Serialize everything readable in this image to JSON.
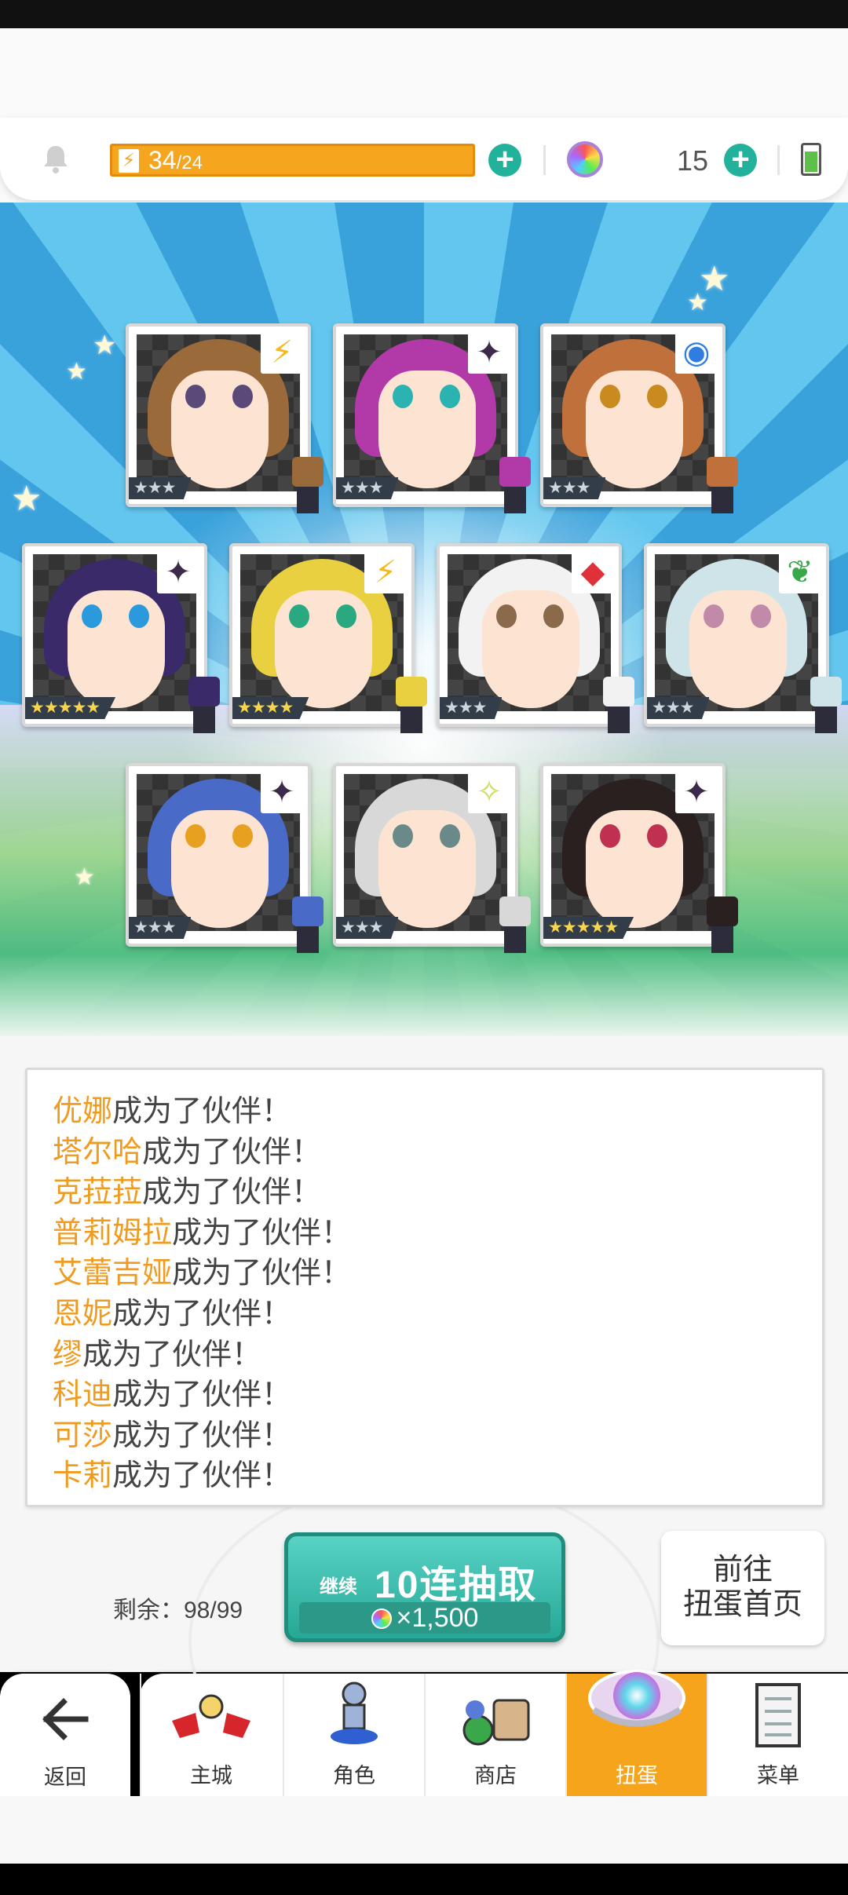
{
  "resources": {
    "stamina_current": "34",
    "stamina_max": "/24",
    "gem_count": "15"
  },
  "cards": [
    {
      "rarity": "★★★",
      "badge": "⚡",
      "badge_color": "#f6b81c",
      "hair": "#9a6a3a",
      "eye": "#5a4a7a"
    },
    {
      "rarity": "★★★",
      "badge": "✦",
      "badge_color": "#3b2a4a",
      "hair": "#b23aa8",
      "eye": "#2ab3b0"
    },
    {
      "rarity": "★★★",
      "badge": "◉",
      "badge_color": "#2f7de0",
      "hair": "#c0703a",
      "eye": "#c98a20"
    },
    {
      "rarity": "★★★★★",
      "badge": "✦",
      "badge_color": "#3b2a4a",
      "hair": "#3a2a6a",
      "eye": "#2a9adc"
    },
    {
      "rarity": "★★★★",
      "badge": "⚡",
      "badge_color": "#f6b81c",
      "hair": "#e8d040",
      "eye": "#2aa880"
    },
    {
      "rarity": "★★★",
      "badge": "◆",
      "badge_color": "#e0303a",
      "hair": "#f2f2f2",
      "eye": "#8a6a4a"
    },
    {
      "rarity": "★★★",
      "badge": "❦",
      "badge_color": "#3aa84a",
      "hair": "#cfe4e8",
      "eye": "#c08aa8"
    },
    {
      "rarity": "★★★",
      "badge": "✦",
      "badge_color": "#3b2a4a",
      "hair": "#4a6ac8",
      "eye": "#e8a020"
    },
    {
      "rarity": "★★★",
      "badge": "✧",
      "badge_color": "#c8e060",
      "hair": "#d8d8d8",
      "eye": "#6a8a8a"
    },
    {
      "rarity": "★★★★★",
      "badge": "✦",
      "badge_color": "#3b2a4a",
      "hair": "#2a2020",
      "eye": "#c03050"
    }
  ],
  "messages": [
    {
      "name": "优娜",
      "text": "成为了伙伴！"
    },
    {
      "name": "塔尔哈",
      "text": "成为了伙伴！"
    },
    {
      "name": "克菈菈",
      "text": "成为了伙伴！"
    },
    {
      "name": "普莉姆拉",
      "text": "成为了伙伴！"
    },
    {
      "name": "艾蕾吉娅",
      "text": "成为了伙伴！"
    },
    {
      "name": "恩妮",
      "text": "成为了伙伴！"
    },
    {
      "name": "缪",
      "text": "成为了伙伴！"
    },
    {
      "name": "科迪",
      "text": "成为了伙伴！"
    },
    {
      "name": "可莎",
      "text": "成为了伙伴！"
    },
    {
      "name": "卡莉",
      "text": "成为了伙伴！"
    }
  ],
  "gacha": {
    "remaining": "剩余：98/99",
    "pull_small": "继续",
    "pull_label": "10连抽取",
    "pull_cost": "×1,500",
    "home_line1": "前往",
    "home_line2": "扭蛋首页"
  },
  "nav": {
    "back": "返回",
    "items": [
      "主城",
      "角色",
      "商店",
      "扭蛋",
      "菜单"
    ],
    "active_index": 3
  },
  "colors": {
    "accent_orange": "#f6a41c",
    "teal": "#22b19a",
    "name_orange": "#ef9b1f"
  }
}
